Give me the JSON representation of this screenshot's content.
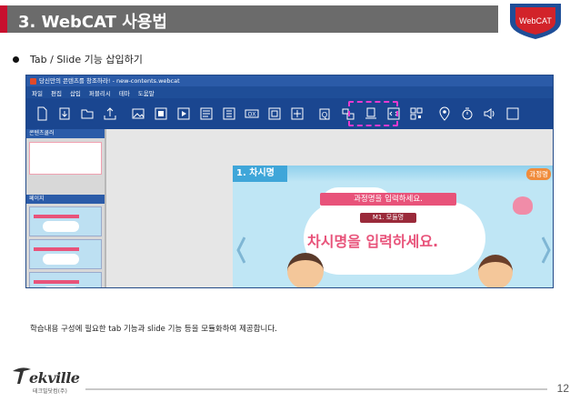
{
  "header": {
    "title": "3. WebCAT 사용법",
    "badge_label": "WebCAT",
    "colors": {
      "bar": "#6b6b6b",
      "accent": "#c8102e",
      "badge_blue": "#1f4e98",
      "badge_red": "#d2232a"
    }
  },
  "bullet": {
    "text": "Tab / Slide 기능 삽입하기"
  },
  "app": {
    "window_title": "당신만의 콘텐츠를 창조하라! - new-contents.webcat",
    "menu": [
      "파일",
      "편집",
      "삽입",
      "퍼블리시",
      "테마",
      "도움말"
    ],
    "toolbar_icons": [
      "new-doc-icon",
      "open-icon",
      "folder-icon",
      "export-icon",
      "image-icon",
      "image-frame-icon",
      "video-icon",
      "text-block-icon",
      "list-block-icon",
      "ox-quiz-icon",
      "quiz-icon",
      "plus-block-icon",
      "question-icon",
      "tab-icon",
      "slide-icon",
      "code-icon",
      "qr-code-icon",
      "location-icon",
      "timer-icon",
      "sound-icon",
      "more-icon"
    ],
    "left_panel": {
      "contents_head": "콘텐츠쿨러",
      "page_head": "페이지"
    },
    "slide": {
      "chapter_tag": "1. 차시명",
      "course_tag_right": "과정명",
      "course_ribbon": "과정명을 입력하세요.",
      "module_label": "M1. 모듈명",
      "main_text": "차시명을 입력하세요."
    }
  },
  "caption": "학습내용 구성에 필요한 tab 기능과 slide 기능 등을 모듈화하여 제공합니다.",
  "footer": {
    "logo_text": "ekville",
    "logo_sub": "테크빌닷컴(주)",
    "page_number": "12"
  }
}
